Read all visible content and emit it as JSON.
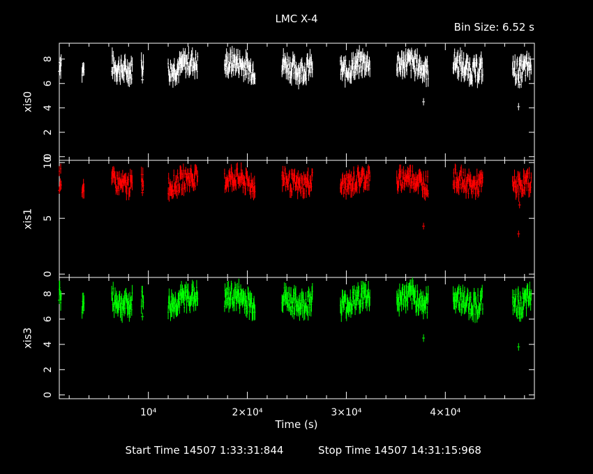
{
  "title": "LMC X-4",
  "bin_size_label": "Bin Size: 6.52 s",
  "footer": {
    "start": "Start Time 14507  1:33:31:844",
    "stop": "Stop Time 14507 14:31:15:968"
  },
  "chart_data": {
    "type": "scatter",
    "xlabel": "Time (s)",
    "xlim": [
      1000,
      49000
    ],
    "x_ticks": [
      {
        "value": 10000,
        "label": "10⁴"
      },
      {
        "value": 20000,
        "label": "2×10⁴"
      },
      {
        "value": 30000,
        "label": "3×10⁴"
      },
      {
        "value": 40000,
        "label": "4×10⁴"
      }
    ],
    "panels": [
      {
        "name": "xis0",
        "color": "#ffffff",
        "ylim": [
          -0.3,
          9.3
        ],
        "y_ticks": [
          0,
          2,
          4,
          6,
          8
        ],
        "base": 7.4,
        "segments": [
          [
            1000,
            1200
          ],
          [
            3300,
            3500
          ],
          [
            6300,
            8400
          ],
          [
            9300,
            9500
          ],
          [
            12000,
            15000
          ],
          [
            17700,
            20800
          ],
          [
            23500,
            26600
          ],
          [
            29400,
            32400
          ],
          [
            35100,
            38300
          ],
          [
            40800,
            43800
          ],
          [
            46800,
            48700
          ]
        ],
        "isolated": [
          [
            1000,
            7.0
          ],
          [
            3400,
            6.9
          ],
          [
            9400,
            6.3
          ],
          [
            37800,
            4.5
          ],
          [
            47400,
            4.1
          ],
          [
            47500,
            5.9
          ]
        ]
      },
      {
        "name": "xis1",
        "color": "#ff0000",
        "ylim": [
          -0.3,
          10.2
        ],
        "y_ticks": [
          0,
          5,
          10
        ],
        "base": 8.3,
        "segments": [
          [
            1000,
            1200
          ],
          [
            3300,
            3500
          ],
          [
            6300,
            8400
          ],
          [
            9300,
            9500
          ],
          [
            12000,
            15000
          ],
          [
            17700,
            20800
          ],
          [
            23500,
            26600
          ],
          [
            29400,
            32400
          ],
          [
            35100,
            38300
          ],
          [
            40800,
            43800
          ],
          [
            46800,
            48700
          ]
        ],
        "isolated": [
          [
            1000,
            7.5
          ],
          [
            3400,
            7.8
          ],
          [
            9400,
            7.3
          ],
          [
            37800,
            4.3
          ],
          [
            47400,
            3.6
          ],
          [
            47500,
            6.2
          ]
        ]
      },
      {
        "name": "xis3",
        "color": "#00ff00",
        "ylim": [
          -0.3,
          9.3
        ],
        "y_ticks": [
          0,
          2,
          4,
          6,
          8
        ],
        "base": 7.5,
        "segments": [
          [
            1000,
            1200
          ],
          [
            3300,
            3500
          ],
          [
            6300,
            8400
          ],
          [
            9300,
            9500
          ],
          [
            12000,
            15000
          ],
          [
            17700,
            20800
          ],
          [
            23500,
            26600
          ],
          [
            29400,
            32400
          ],
          [
            35100,
            38300
          ],
          [
            40800,
            43800
          ],
          [
            46800,
            48700
          ]
        ],
        "isolated": [
          [
            1000,
            7.5
          ],
          [
            3400,
            6.7
          ],
          [
            9400,
            6.2
          ],
          [
            37800,
            4.5
          ],
          [
            47400,
            3.8
          ],
          [
            47500,
            6.1
          ]
        ]
      }
    ]
  }
}
